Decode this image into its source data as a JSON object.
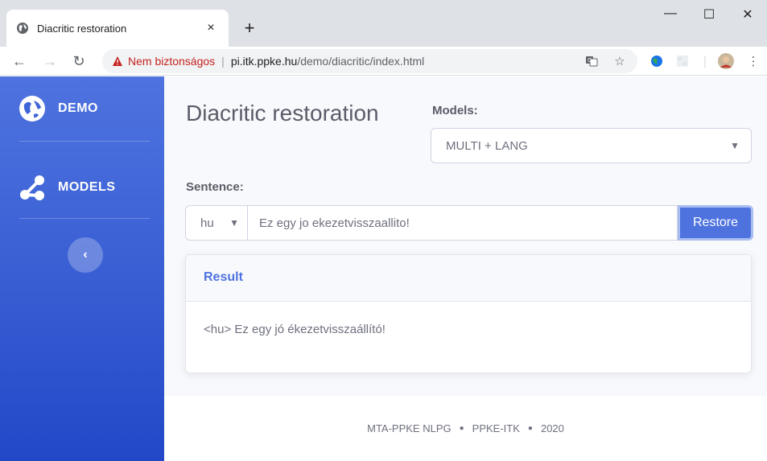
{
  "browser": {
    "tab_title": "Diacritic restoration",
    "tab_close": "×",
    "new_tab": "+",
    "minimize": "—",
    "maximize": "☐",
    "close": "✕",
    "security_label": "Nem biztonságos",
    "url_host": "pi.itk.ppke.hu",
    "url_path": "/demo/diacritic/index.html"
  },
  "sidebar": {
    "items": [
      {
        "label": "DEMO",
        "icon": "globe-icon"
      },
      {
        "label": "MODELS",
        "icon": "share-nodes-icon"
      }
    ],
    "toggle_glyph": "‹"
  },
  "main": {
    "title": "Diacritic restoration",
    "models_label": "Models:",
    "models_value": "MULTI + LANG",
    "sentence_label": "Sentence:",
    "lang_value": "hu",
    "sentence_value": "Ez egy jo ekezetvisszaallito!",
    "restore_label": "Restore",
    "result_header": "Result",
    "result_text": "<hu> Ez egy jó ékezetvisszaállító!"
  },
  "footer": {
    "org": "MTA-PPKE NLPG",
    "faculty": "PPKE-ITK",
    "year": "2020",
    "separator": "●"
  },
  "colors": {
    "accent": "#4e73df",
    "sidebar_top": "#4e73df",
    "sidebar_bottom": "#2248c8",
    "warning": "#c5221f"
  }
}
